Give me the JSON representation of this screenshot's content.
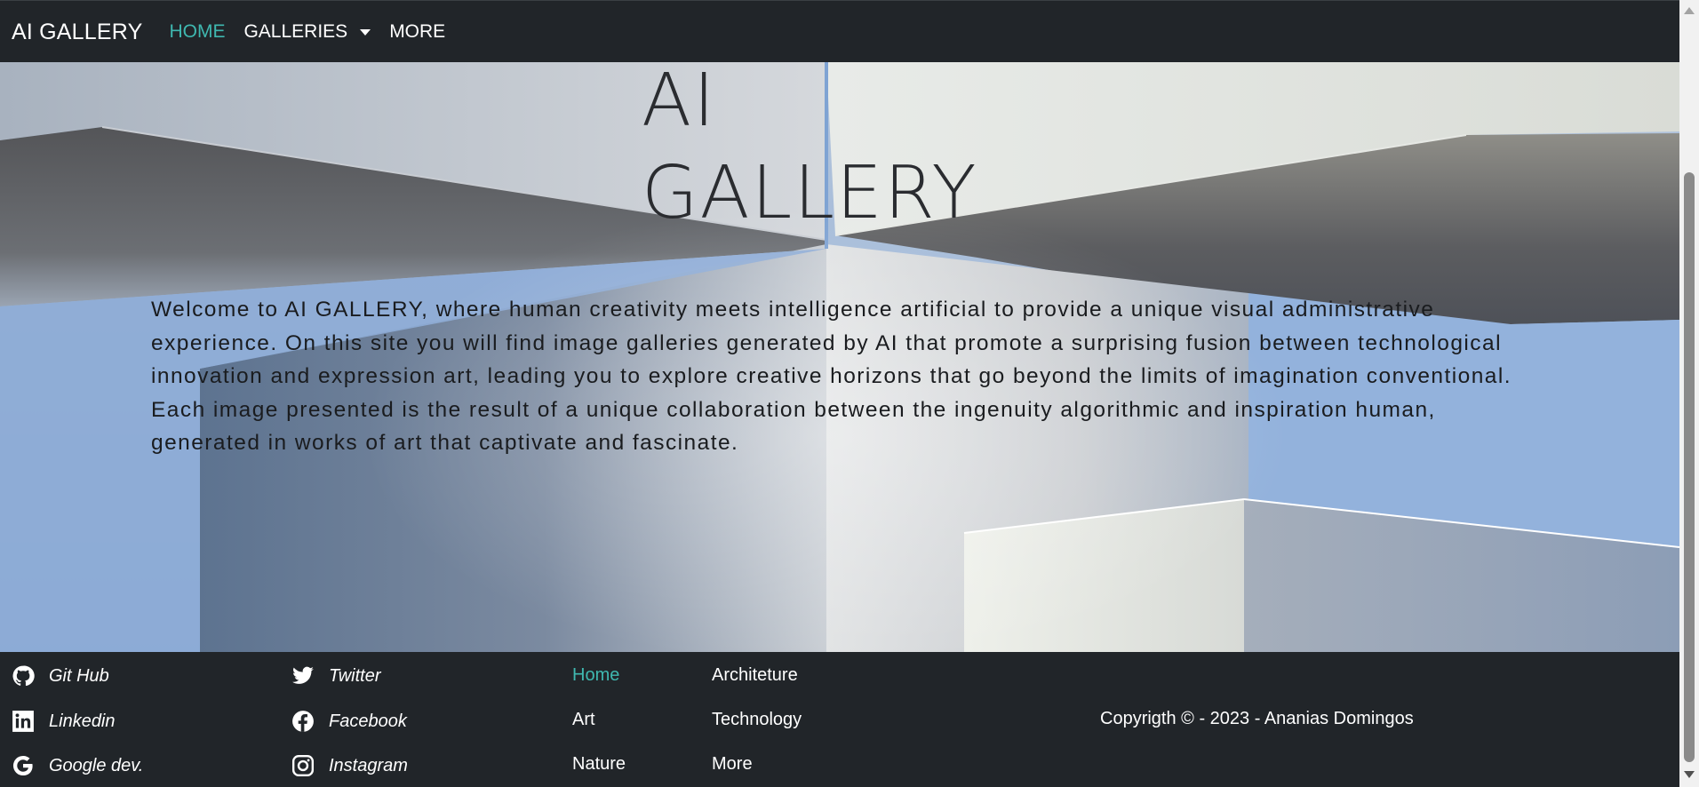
{
  "navbar": {
    "brand": "AI GALLERY",
    "links": [
      {
        "label": "HOME",
        "active": true
      },
      {
        "label": "GALLERIES",
        "dropdown": true
      },
      {
        "label": "MORE"
      }
    ]
  },
  "hero": {
    "title_line1": "AI",
    "title_line2": "GALLERY",
    "intro": "Welcome to AI GALLERY, where human creativity meets intelligence artificial to provide a unique visual administrative experience. On this site you will find image galleries generated by AI that promote a surprising fusion between technological innovation and expression art, leading you to explore creative horizons that go beyond the limits of imagination conventional. Each image presented is the result of a unique collaboration between the ingenuity algorithmic and inspiration human, generated in works of art that captivate and fascinate."
  },
  "footer": {
    "social": [
      {
        "label": "Git Hub",
        "icon": "github-icon"
      },
      {
        "label": "Linkedin",
        "icon": "linkedin-icon"
      },
      {
        "label": "Google dev.",
        "icon": "google-icon"
      },
      {
        "label": "Twitter",
        "icon": "twitter-icon"
      },
      {
        "label": "Facebook",
        "icon": "facebook-icon"
      },
      {
        "label": "Instagram",
        "icon": "instagram-icon"
      }
    ],
    "links": [
      {
        "label": "Home",
        "active": true
      },
      {
        "label": "Art"
      },
      {
        "label": "Nature"
      },
      {
        "label": "Architeture"
      },
      {
        "label": "Technology"
      },
      {
        "label": "More"
      }
    ],
    "copyright": "Copyrigth © - 2023 - Ananias Domingos"
  },
  "colors": {
    "dark": "#212529",
    "accent": "#3fb8b0",
    "sky": "#8fb0d8"
  }
}
